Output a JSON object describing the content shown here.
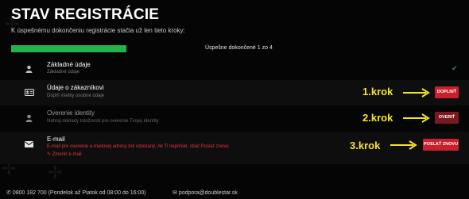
{
  "header": {
    "title": "STAV REGISTRÁCIE",
    "subtitle": "K úspešnému dokončeniu registrácie stačia už len tieto kroky:"
  },
  "progress": {
    "text": "Úspešne dokončené 1 zo 4",
    "completed": 1,
    "total": 4
  },
  "steps": [
    {
      "icon": "user-icon",
      "title": "Základné údaje",
      "description": "Základné údaje",
      "status_icon": "check-icon",
      "status_symbol": "✔"
    },
    {
      "icon": "id-card-icon",
      "title": "Údaje o zákazníkovi",
      "description": "Doplň všetky osobné údaje",
      "button": "DOPLNIŤ"
    },
    {
      "icon": "user-icon",
      "title": "Overenie identity",
      "description": "Nahraj doklady totožnosti pre overenie Tvojej identity",
      "button": "OVERIŤ"
    },
    {
      "icon": "envelope-icon",
      "title": "E-mail",
      "description": "E-mail pre overenie e-mailovej adresy bol odoslaný. Ak Ti neprišiel, stlač Poslať znovu",
      "link": "Zmeniť e-mail",
      "button": "POSLAŤ ZNOVU"
    }
  ],
  "annotations": [
    "1.krok",
    "2.krok",
    "3.krok"
  ],
  "footer": {
    "phone": "0800 182 700 (Pondelok až Piatok od 08:00 do 16:00)",
    "email": "podpora@doublestar.sk"
  },
  "colors": {
    "progress": "#22b24c",
    "button": "#c8202d",
    "annotation": "#f5e622",
    "error": "#e2353f"
  }
}
